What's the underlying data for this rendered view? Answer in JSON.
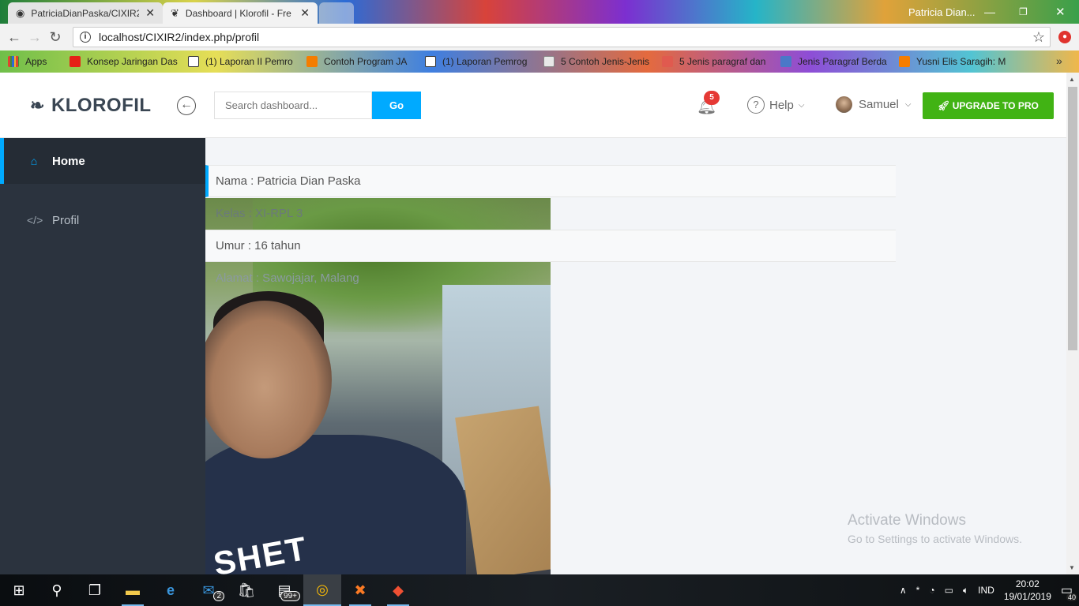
{
  "browser": {
    "tabs": [
      {
        "title": "PatriciaDianPaska/CIXIR2",
        "icon": "github-icon"
      },
      {
        "title": "Dashboard | Klorofil - Fre",
        "icon": "leaf-icon"
      }
    ],
    "profile_name": "Patricia Dian...",
    "url": "localhost/CIXIR2/index.php/profil",
    "bookmarks": [
      {
        "label": "Apps",
        "color": "#e0442f"
      },
      {
        "label": "Konsep Jaringan Das",
        "color": "#e62117"
      },
      {
        "label": "(1) Laporan II Pemro",
        "color": "#ffffff"
      },
      {
        "label": "Contoh Program JA",
        "color": "#f57d00"
      },
      {
        "label": "(1) Laporan Pemrog",
        "color": "#ffffff"
      },
      {
        "label": "5 Contoh Jenis-Jenis",
        "color": "#e8e8e8"
      },
      {
        "label": "5 Jenis paragraf dan",
        "color": "#e05a4f"
      },
      {
        "label": "Jenis Paragraf Berda",
        "color": "#4a78c8"
      },
      {
        "label": "Yusni Elis Saragih: M",
        "color": "#f57d00"
      }
    ],
    "more_bookmarks": "»"
  },
  "app": {
    "brand": "KLOROFIL",
    "search_placeholder": "Search dashboard...",
    "go_label": "Go",
    "notification_count": "5",
    "help_label": "Help",
    "user_name": "Samuel",
    "upgrade_label": "UPGRADE TO PRO",
    "accent": "#00aaff",
    "upgrade_color": "#41b314"
  },
  "sidebar": {
    "items": [
      {
        "label": "Home",
        "icon": "home-icon",
        "active": true
      },
      {
        "label": "Profil",
        "icon": "code-icon",
        "active": false
      }
    ]
  },
  "profile": {
    "nama": "Nama : Patricia Dian Paska",
    "kelas": "Kelas : XI-RPL 3",
    "umur": "Umur : 16 tahun",
    "alamat": "Alamat : Sawojajar, Malang",
    "photo_print": "SHET"
  },
  "watermark": {
    "line1": "Activate Windows",
    "line2": "Go to Settings to activate Windows."
  },
  "taskbar": {
    "mail_badge": "2",
    "store_badge": "99+",
    "language": "IND",
    "time": "20:02",
    "date": "19/01/2019",
    "notification_count": "40"
  }
}
